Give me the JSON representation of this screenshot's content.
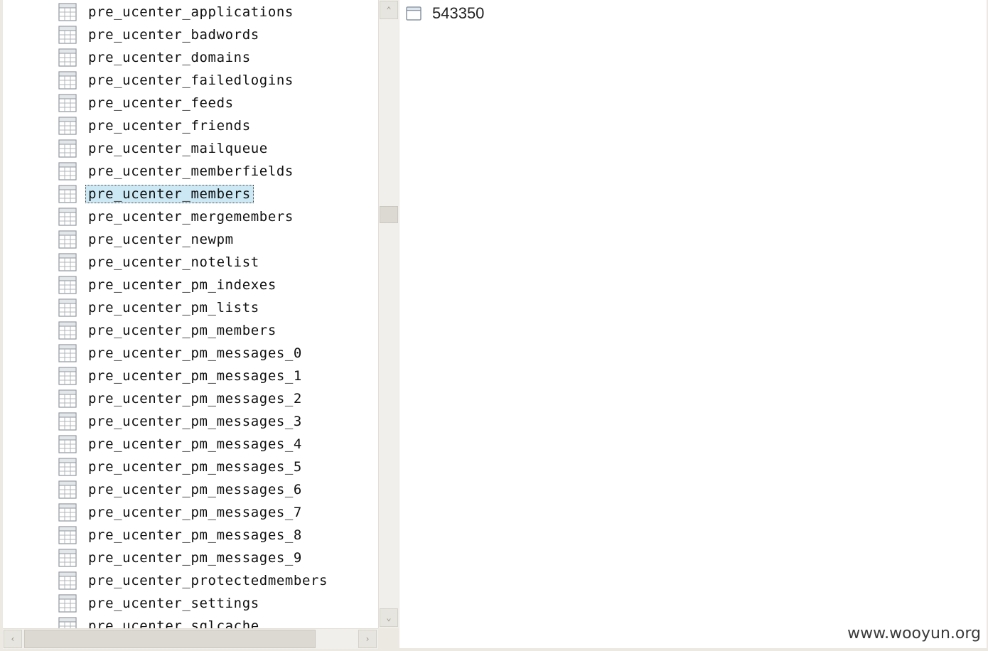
{
  "tree": {
    "items": [
      {
        "label": "pre_ucenter_applications"
      },
      {
        "label": "pre_ucenter_badwords"
      },
      {
        "label": "pre_ucenter_domains"
      },
      {
        "label": "pre_ucenter_failedlogins"
      },
      {
        "label": "pre_ucenter_feeds"
      },
      {
        "label": "pre_ucenter_friends"
      },
      {
        "label": "pre_ucenter_mailqueue"
      },
      {
        "label": "pre_ucenter_memberfields"
      },
      {
        "label": "pre_ucenter_members",
        "selected": true
      },
      {
        "label": "pre_ucenter_mergemembers"
      },
      {
        "label": "pre_ucenter_newpm"
      },
      {
        "label": "pre_ucenter_notelist"
      },
      {
        "label": "pre_ucenter_pm_indexes"
      },
      {
        "label": "pre_ucenter_pm_lists"
      },
      {
        "label": "pre_ucenter_pm_members"
      },
      {
        "label": "pre_ucenter_pm_messages_0"
      },
      {
        "label": "pre_ucenter_pm_messages_1"
      },
      {
        "label": "pre_ucenter_pm_messages_2"
      },
      {
        "label": "pre_ucenter_pm_messages_3"
      },
      {
        "label": "pre_ucenter_pm_messages_4"
      },
      {
        "label": "pre_ucenter_pm_messages_5"
      },
      {
        "label": "pre_ucenter_pm_messages_6"
      },
      {
        "label": "pre_ucenter_pm_messages_7"
      },
      {
        "label": "pre_ucenter_pm_messages_8"
      },
      {
        "label": "pre_ucenter_pm_messages_9"
      },
      {
        "label": "pre_ucenter_protectedmembers"
      },
      {
        "label": "pre_ucenter_settings"
      },
      {
        "label": "pre_ucenter_sqlcache"
      }
    ],
    "icon": "table-grid-icon"
  },
  "detail": {
    "value": "543350",
    "icon": "window-icon"
  },
  "watermark": "www.wooyun.org",
  "colors": {
    "selection": "#cce8f4",
    "background": "#ece9e3"
  }
}
